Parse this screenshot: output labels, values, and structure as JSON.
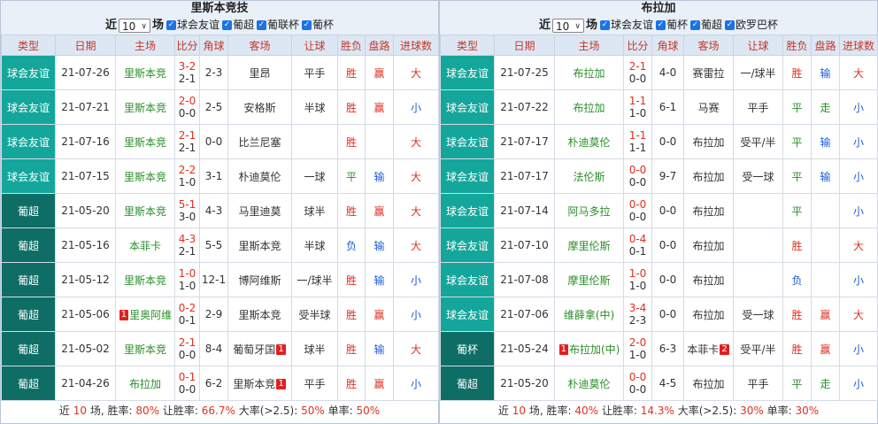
{
  "left": {
    "team": "里斯本竞技",
    "filter": {
      "near": "近",
      "count": "10",
      "unit": "场",
      "checks": [
        "球会友谊",
        "葡超",
        "葡联杯",
        "葡杯"
      ]
    },
    "headers": [
      "类型",
      "日期",
      "主场",
      "比分",
      "角球",
      "客场",
      "让球",
      "胜负",
      "盘路",
      "进球数"
    ],
    "rows": [
      {
        "type": "球会友谊",
        "kind": "friendly",
        "date": "21-07-26",
        "home": "里斯本竞",
        "home_card": "",
        "ft": "3-2",
        "ht": "2-1",
        "corner": "2-3",
        "away": "里昂",
        "away_card": "",
        "handicap": "平手",
        "result": "胜",
        "result_kind": "win",
        "pan": "赢",
        "pan_kind": "win",
        "ou": "大",
        "ou_kind": "big"
      },
      {
        "type": "球会友谊",
        "kind": "friendly",
        "date": "21-07-21",
        "home": "里斯本竞",
        "home_card": "",
        "ft": "2-0",
        "ht": "0-0",
        "corner": "2-5",
        "away": "安格斯",
        "away_card": "",
        "handicap": "半球",
        "result": "胜",
        "result_kind": "win",
        "pan": "赢",
        "pan_kind": "win",
        "ou": "小",
        "ou_kind": "small"
      },
      {
        "type": "球会友谊",
        "kind": "friendly",
        "date": "21-07-16",
        "home": "里斯本竞",
        "home_card": "",
        "ft": "2-1",
        "ht": "2-1",
        "corner": "0-0",
        "away": "比兰尼塞",
        "away_card": "",
        "handicap": "",
        "result": "胜",
        "result_kind": "win",
        "pan": "",
        "pan_kind": "",
        "ou": "大",
        "ou_kind": "big"
      },
      {
        "type": "球会友谊",
        "kind": "friendly",
        "date": "21-07-15",
        "home": "里斯本竞",
        "home_card": "",
        "ft": "2-2",
        "ht": "1-0",
        "corner": "3-1",
        "away": "朴迪莫伦",
        "away_card": "",
        "handicap": "一球",
        "result": "平",
        "result_kind": "draw",
        "pan": "输",
        "pan_kind": "lose",
        "ou": "大",
        "ou_kind": "big"
      },
      {
        "type": "葡超",
        "kind": "portugal",
        "date": "21-05-20",
        "home": "里斯本竞",
        "home_card": "",
        "ft": "5-1",
        "ht": "3-0",
        "corner": "4-3",
        "away": "马里迪莫",
        "away_card": "",
        "handicap": "球半",
        "result": "胜",
        "result_kind": "win",
        "pan": "赢",
        "pan_kind": "win",
        "ou": "大",
        "ou_kind": "big"
      },
      {
        "type": "葡超",
        "kind": "portugal",
        "date": "21-05-16",
        "home": "本菲卡",
        "home_card": "",
        "ft": "4-3",
        "ht": "2-1",
        "corner": "5-5",
        "away": "里斯本竞",
        "away_card": "",
        "handicap": "半球",
        "result": "负",
        "result_kind": "lose",
        "pan": "输",
        "pan_kind": "lose",
        "ou": "大",
        "ou_kind": "big"
      },
      {
        "type": "葡超",
        "kind": "portugal",
        "date": "21-05-12",
        "home": "里斯本竞",
        "home_card": "",
        "ft": "1-0",
        "ht": "1-0",
        "corner": "12-1",
        "away": "博阿维斯",
        "away_card": "",
        "handicap": "一/球半",
        "result": "胜",
        "result_kind": "win",
        "pan": "输",
        "pan_kind": "lose",
        "ou": "小",
        "ou_kind": "small"
      },
      {
        "type": "葡超",
        "kind": "portugal",
        "date": "21-05-06",
        "home": "里奥阿维",
        "home_card": "1",
        "ft": "0-2",
        "ht": "0-1",
        "corner": "2-9",
        "away": "里斯本竞",
        "away_card": "",
        "handicap": "受半球",
        "result": "胜",
        "result_kind": "win",
        "pan": "赢",
        "pan_kind": "win",
        "ou": "小",
        "ou_kind": "small"
      },
      {
        "type": "葡超",
        "kind": "portugal",
        "date": "21-05-02",
        "home": "里斯本竞",
        "home_card": "",
        "ft": "2-1",
        "ht": "0-0",
        "corner": "8-4",
        "away": "葡萄牙国",
        "away_card": "1",
        "handicap": "球半",
        "result": "胜",
        "result_kind": "win",
        "pan": "输",
        "pan_kind": "lose",
        "ou": "大",
        "ou_kind": "big"
      },
      {
        "type": "葡超",
        "kind": "portugal",
        "date": "21-04-26",
        "home": "布拉加",
        "home_card": "",
        "ft": "0-1",
        "ht": "0-0",
        "corner": "6-2",
        "away": "里斯本竞",
        "away_card": "1",
        "handicap": "平手",
        "result": "胜",
        "result_kind": "win",
        "pan": "赢",
        "pan_kind": "win",
        "ou": "小",
        "ou_kind": "small"
      }
    ],
    "summary": {
      "prefix": "近",
      "count": "10",
      "mid": "场, 胜率:",
      "win_rate": "80%",
      "r_label": "让胜率:",
      "r_rate": "66.7%",
      "big_label": "大率(>2.5):",
      "big_rate": "50%",
      "odd_label": "单率:",
      "odd_rate": "50%"
    }
  },
  "right": {
    "team": "布拉加",
    "filter": {
      "near": "近",
      "count": "10",
      "unit": "场",
      "checks": [
        "球会友谊",
        "葡杯",
        "葡超",
        "欧罗巴杯"
      ]
    },
    "headers": [
      "类型",
      "日期",
      "主场",
      "比分",
      "角球",
      "客场",
      "让球",
      "胜负",
      "盘路",
      "进球数"
    ],
    "rows": [
      {
        "type": "球会友谊",
        "kind": "friendly",
        "date": "21-07-25",
        "home": "布拉加",
        "home_card": "",
        "ft": "2-1",
        "ht": "0-0",
        "corner": "4-0",
        "away": "赛雷拉",
        "away_card": "",
        "handicap": "一/球半",
        "result": "胜",
        "result_kind": "win",
        "pan": "输",
        "pan_kind": "lose",
        "ou": "大",
        "ou_kind": "big"
      },
      {
        "type": "球会友谊",
        "kind": "friendly",
        "date": "21-07-22",
        "home": "布拉加",
        "home_card": "",
        "ft": "1-1",
        "ht": "1-0",
        "corner": "6-1",
        "away": "马赛",
        "away_card": "",
        "handicap": "平手",
        "result": "平",
        "result_kind": "draw",
        "pan": "走",
        "pan_kind": "draw",
        "ou": "小",
        "ou_kind": "small"
      },
      {
        "type": "球会友谊",
        "kind": "friendly",
        "date": "21-07-17",
        "home": "朴迪莫伦",
        "home_card": "",
        "ft": "1-1",
        "ht": "1-1",
        "corner": "0-0",
        "away": "布拉加",
        "away_card": "",
        "handicap": "受平/半",
        "result": "平",
        "result_kind": "draw",
        "pan": "输",
        "pan_kind": "lose",
        "ou": "小",
        "ou_kind": "small"
      },
      {
        "type": "球会友谊",
        "kind": "friendly",
        "date": "21-07-17",
        "home": "法伦斯",
        "home_card": "",
        "ft": "0-0",
        "ht": "0-0",
        "corner": "9-7",
        "away": "布拉加",
        "away_card": "",
        "handicap": "受一球",
        "result": "平",
        "result_kind": "draw",
        "pan": "输",
        "pan_kind": "lose",
        "ou": "小",
        "ou_kind": "small"
      },
      {
        "type": "球会友谊",
        "kind": "friendly",
        "date": "21-07-14",
        "home": "阿马多拉",
        "home_card": "",
        "ft": "0-0",
        "ht": "0-0",
        "corner": "0-0",
        "away": "布拉加",
        "away_card": "",
        "handicap": "",
        "result": "平",
        "result_kind": "draw",
        "pan": "",
        "pan_kind": "",
        "ou": "小",
        "ou_kind": "small"
      },
      {
        "type": "球会友谊",
        "kind": "friendly",
        "date": "21-07-10",
        "home": "摩里伦斯",
        "home_card": "",
        "ft": "0-4",
        "ht": "0-1",
        "corner": "0-0",
        "away": "布拉加",
        "away_card": "",
        "handicap": "",
        "result": "胜",
        "result_kind": "win",
        "pan": "",
        "pan_kind": "",
        "ou": "大",
        "ou_kind": "big"
      },
      {
        "type": "球会友谊",
        "kind": "friendly",
        "date": "21-07-08",
        "home": "摩里伦斯",
        "home_card": "",
        "ft": "1-0",
        "ht": "1-0",
        "corner": "0-0",
        "away": "布拉加",
        "away_card": "",
        "handicap": "",
        "result": "负",
        "result_kind": "lose",
        "pan": "",
        "pan_kind": "",
        "ou": "小",
        "ou_kind": "small"
      },
      {
        "type": "球会友谊",
        "kind": "friendly",
        "date": "21-07-06",
        "home": "维薛拿(中)",
        "home_card": "",
        "ft": "3-4",
        "ht": "2-3",
        "corner": "0-0",
        "away": "布拉加",
        "away_card": "",
        "handicap": "受一球",
        "result": "胜",
        "result_kind": "win",
        "pan": "赢",
        "pan_kind": "win",
        "ou": "大",
        "ou_kind": "big"
      },
      {
        "type": "葡杯",
        "kind": "portugal",
        "date": "21-05-24",
        "home": "布拉加(中)",
        "home_card": "1",
        "ft": "2-0",
        "ht": "1-0",
        "corner": "6-3",
        "away": "本菲卡",
        "away_card": "2",
        "handicap": "受平/半",
        "result": "胜",
        "result_kind": "win",
        "pan": "赢",
        "pan_kind": "win",
        "ou": "小",
        "ou_kind": "small"
      },
      {
        "type": "葡超",
        "kind": "portugal",
        "date": "21-05-20",
        "home": "朴迪莫伦",
        "home_card": "",
        "ft": "0-0",
        "ht": "0-0",
        "corner": "4-5",
        "away": "布拉加",
        "away_card": "",
        "handicap": "平手",
        "result": "平",
        "result_kind": "draw",
        "pan": "走",
        "pan_kind": "draw",
        "ou": "小",
        "ou_kind": "small"
      }
    ],
    "summary": {
      "prefix": "近",
      "count": "10",
      "mid": "场, 胜率:",
      "win_rate": "40%",
      "r_label": "让胜率:",
      "r_rate": "14.3%",
      "big_label": "大率(>2.5):",
      "big_rate": "30%",
      "odd_label": "单率:",
      "odd_rate": "30%"
    }
  }
}
